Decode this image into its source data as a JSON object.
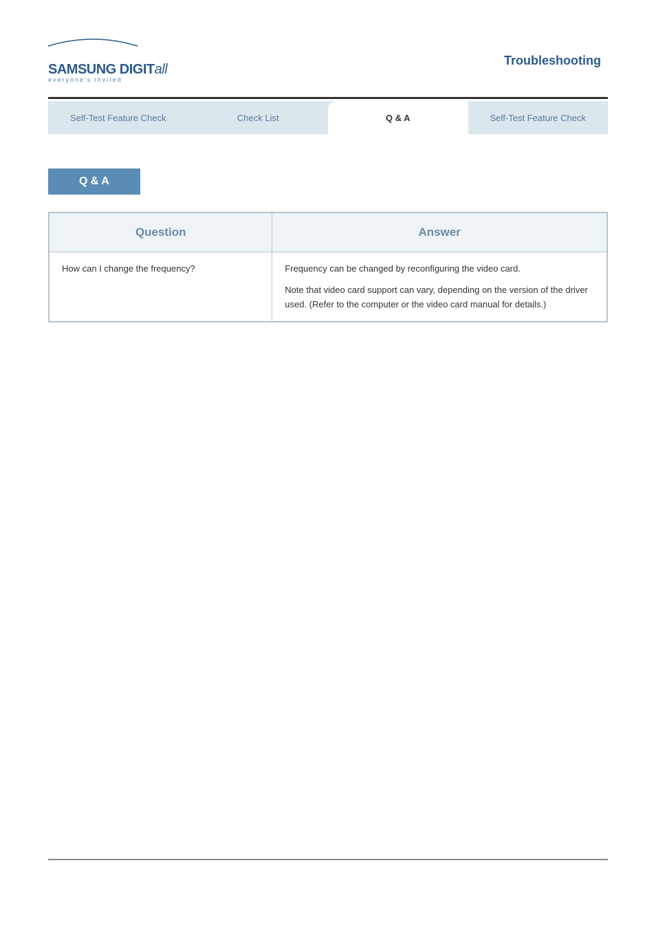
{
  "logo": {
    "brand_bold": "SAMSUNG DIGIT",
    "brand_italic": "all",
    "tagline": "everyone's invited"
  },
  "header": {
    "title": "Troubleshooting"
  },
  "tabs": [
    {
      "label": "Self-Test Feature Check"
    },
    {
      "label": "Check List"
    },
    {
      "label": "Q & A"
    },
    {
      "label": "Self-Test Feature Check"
    }
  ],
  "section_badge": "Q & A",
  "qa": {
    "header_q": "Question",
    "header_a": "Answer",
    "rows": [
      {
        "q": "How can I change the frequency?",
        "a_line1": "Frequency can be changed by reconfiguring the video card.",
        "a_line2": "Note that video card support can vary, depending on the version of the driver used. (Refer to the computer or the video card manual for details.)"
      }
    ]
  }
}
